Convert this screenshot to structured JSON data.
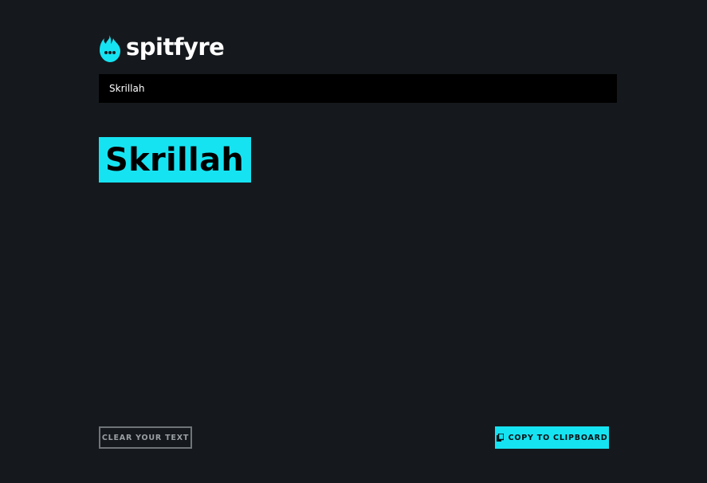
{
  "brand": {
    "name": "spitfyre",
    "icon": "flame-chat-icon",
    "accent_color": "#16e3f2"
  },
  "input": {
    "value": "Skrillah"
  },
  "output": {
    "text": "Skrillah"
  },
  "actions": {
    "clear_label": "CLEAR YOUR TEXT",
    "copy_label": "COPY TO CLIPBOARD",
    "copy_icon": "clipboard-icon"
  },
  "colors": {
    "background": "#15191d",
    "input_background": "#000000",
    "accent": "#16e3f2"
  }
}
